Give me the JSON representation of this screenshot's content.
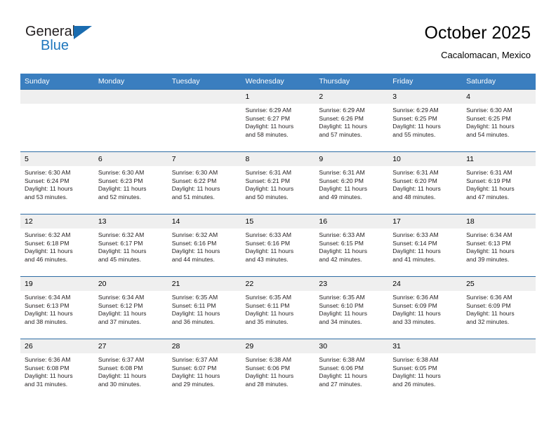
{
  "logo": {
    "word_one": "General",
    "word_two": "Blue",
    "triangle_color": "#1a6cb0"
  },
  "header": {
    "title": "October 2025",
    "location": "Cacalomacan, Mexico"
  },
  "theme": {
    "header_row_bg": "#3a7ebf",
    "week_divider": "#2e6da4",
    "daynum_bg": "#efefef",
    "brand_blue": "#1e76bd"
  },
  "weekday_headers": [
    "Sunday",
    "Monday",
    "Tuesday",
    "Wednesday",
    "Thursday",
    "Friday",
    "Saturday"
  ],
  "labels": {
    "sunrise_prefix": "Sunrise:",
    "sunset_prefix": "Sunset:",
    "daylight_prefix": "Daylight:"
  },
  "weeks": [
    [
      {
        "day": "",
        "sunrise": "",
        "sunset": "",
        "daylight_line1": "",
        "daylight_line2": ""
      },
      {
        "day": "",
        "sunrise": "",
        "sunset": "",
        "daylight_line1": "",
        "daylight_line2": ""
      },
      {
        "day": "",
        "sunrise": "",
        "sunset": "",
        "daylight_line1": "",
        "daylight_line2": ""
      },
      {
        "day": "1",
        "sunrise": "Sunrise: 6:29 AM",
        "sunset": "Sunset: 6:27 PM",
        "daylight_line1": "Daylight: 11 hours",
        "daylight_line2": "and 58 minutes."
      },
      {
        "day": "2",
        "sunrise": "Sunrise: 6:29 AM",
        "sunset": "Sunset: 6:26 PM",
        "daylight_line1": "Daylight: 11 hours",
        "daylight_line2": "and 57 minutes."
      },
      {
        "day": "3",
        "sunrise": "Sunrise: 6:29 AM",
        "sunset": "Sunset: 6:25 PM",
        "daylight_line1": "Daylight: 11 hours",
        "daylight_line2": "and 55 minutes."
      },
      {
        "day": "4",
        "sunrise": "Sunrise: 6:30 AM",
        "sunset": "Sunset: 6:25 PM",
        "daylight_line1": "Daylight: 11 hours",
        "daylight_line2": "and 54 minutes."
      }
    ],
    [
      {
        "day": "5",
        "sunrise": "Sunrise: 6:30 AM",
        "sunset": "Sunset: 6:24 PM",
        "daylight_line1": "Daylight: 11 hours",
        "daylight_line2": "and 53 minutes."
      },
      {
        "day": "6",
        "sunrise": "Sunrise: 6:30 AM",
        "sunset": "Sunset: 6:23 PM",
        "daylight_line1": "Daylight: 11 hours",
        "daylight_line2": "and 52 minutes."
      },
      {
        "day": "7",
        "sunrise": "Sunrise: 6:30 AM",
        "sunset": "Sunset: 6:22 PM",
        "daylight_line1": "Daylight: 11 hours",
        "daylight_line2": "and 51 minutes."
      },
      {
        "day": "8",
        "sunrise": "Sunrise: 6:31 AM",
        "sunset": "Sunset: 6:21 PM",
        "daylight_line1": "Daylight: 11 hours",
        "daylight_line2": "and 50 minutes."
      },
      {
        "day": "9",
        "sunrise": "Sunrise: 6:31 AM",
        "sunset": "Sunset: 6:20 PM",
        "daylight_line1": "Daylight: 11 hours",
        "daylight_line2": "and 49 minutes."
      },
      {
        "day": "10",
        "sunrise": "Sunrise: 6:31 AM",
        "sunset": "Sunset: 6:20 PM",
        "daylight_line1": "Daylight: 11 hours",
        "daylight_line2": "and 48 minutes."
      },
      {
        "day": "11",
        "sunrise": "Sunrise: 6:31 AM",
        "sunset": "Sunset: 6:19 PM",
        "daylight_line1": "Daylight: 11 hours",
        "daylight_line2": "and 47 minutes."
      }
    ],
    [
      {
        "day": "12",
        "sunrise": "Sunrise: 6:32 AM",
        "sunset": "Sunset: 6:18 PM",
        "daylight_line1": "Daylight: 11 hours",
        "daylight_line2": "and 46 minutes."
      },
      {
        "day": "13",
        "sunrise": "Sunrise: 6:32 AM",
        "sunset": "Sunset: 6:17 PM",
        "daylight_line1": "Daylight: 11 hours",
        "daylight_line2": "and 45 minutes."
      },
      {
        "day": "14",
        "sunrise": "Sunrise: 6:32 AM",
        "sunset": "Sunset: 6:16 PM",
        "daylight_line1": "Daylight: 11 hours",
        "daylight_line2": "and 44 minutes."
      },
      {
        "day": "15",
        "sunrise": "Sunrise: 6:33 AM",
        "sunset": "Sunset: 6:16 PM",
        "daylight_line1": "Daylight: 11 hours",
        "daylight_line2": "and 43 minutes."
      },
      {
        "day": "16",
        "sunrise": "Sunrise: 6:33 AM",
        "sunset": "Sunset: 6:15 PM",
        "daylight_line1": "Daylight: 11 hours",
        "daylight_line2": "and 42 minutes."
      },
      {
        "day": "17",
        "sunrise": "Sunrise: 6:33 AM",
        "sunset": "Sunset: 6:14 PM",
        "daylight_line1": "Daylight: 11 hours",
        "daylight_line2": "and 41 minutes."
      },
      {
        "day": "18",
        "sunrise": "Sunrise: 6:34 AM",
        "sunset": "Sunset: 6:13 PM",
        "daylight_line1": "Daylight: 11 hours",
        "daylight_line2": "and 39 minutes."
      }
    ],
    [
      {
        "day": "19",
        "sunrise": "Sunrise: 6:34 AM",
        "sunset": "Sunset: 6:13 PM",
        "daylight_line1": "Daylight: 11 hours",
        "daylight_line2": "and 38 minutes."
      },
      {
        "day": "20",
        "sunrise": "Sunrise: 6:34 AM",
        "sunset": "Sunset: 6:12 PM",
        "daylight_line1": "Daylight: 11 hours",
        "daylight_line2": "and 37 minutes."
      },
      {
        "day": "21",
        "sunrise": "Sunrise: 6:35 AM",
        "sunset": "Sunset: 6:11 PM",
        "daylight_line1": "Daylight: 11 hours",
        "daylight_line2": "and 36 minutes."
      },
      {
        "day": "22",
        "sunrise": "Sunrise: 6:35 AM",
        "sunset": "Sunset: 6:11 PM",
        "daylight_line1": "Daylight: 11 hours",
        "daylight_line2": "and 35 minutes."
      },
      {
        "day": "23",
        "sunrise": "Sunrise: 6:35 AM",
        "sunset": "Sunset: 6:10 PM",
        "daylight_line1": "Daylight: 11 hours",
        "daylight_line2": "and 34 minutes."
      },
      {
        "day": "24",
        "sunrise": "Sunrise: 6:36 AM",
        "sunset": "Sunset: 6:09 PM",
        "daylight_line1": "Daylight: 11 hours",
        "daylight_line2": "and 33 minutes."
      },
      {
        "day": "25",
        "sunrise": "Sunrise: 6:36 AM",
        "sunset": "Sunset: 6:09 PM",
        "daylight_line1": "Daylight: 11 hours",
        "daylight_line2": "and 32 minutes."
      }
    ],
    [
      {
        "day": "26",
        "sunrise": "Sunrise: 6:36 AM",
        "sunset": "Sunset: 6:08 PM",
        "daylight_line1": "Daylight: 11 hours",
        "daylight_line2": "and 31 minutes."
      },
      {
        "day": "27",
        "sunrise": "Sunrise: 6:37 AM",
        "sunset": "Sunset: 6:08 PM",
        "daylight_line1": "Daylight: 11 hours",
        "daylight_line2": "and 30 minutes."
      },
      {
        "day": "28",
        "sunrise": "Sunrise: 6:37 AM",
        "sunset": "Sunset: 6:07 PM",
        "daylight_line1": "Daylight: 11 hours",
        "daylight_line2": "and 29 minutes."
      },
      {
        "day": "29",
        "sunrise": "Sunrise: 6:38 AM",
        "sunset": "Sunset: 6:06 PM",
        "daylight_line1": "Daylight: 11 hours",
        "daylight_line2": "and 28 minutes."
      },
      {
        "day": "30",
        "sunrise": "Sunrise: 6:38 AM",
        "sunset": "Sunset: 6:06 PM",
        "daylight_line1": "Daylight: 11 hours",
        "daylight_line2": "and 27 minutes."
      },
      {
        "day": "31",
        "sunrise": "Sunrise: 6:38 AM",
        "sunset": "Sunset: 6:05 PM",
        "daylight_line1": "Daylight: 11 hours",
        "daylight_line2": "and 26 minutes."
      },
      {
        "day": "",
        "sunrise": "",
        "sunset": "",
        "daylight_line1": "",
        "daylight_line2": ""
      }
    ]
  ]
}
